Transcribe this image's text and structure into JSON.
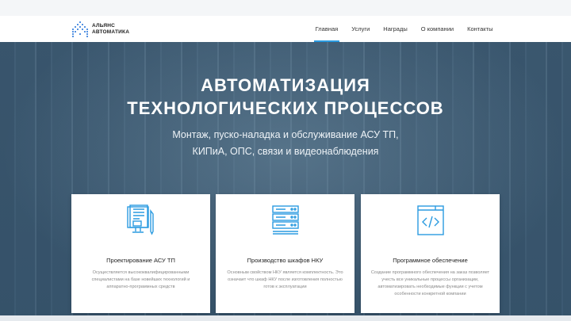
{
  "logo": {
    "line1": "АЛЬЯНС",
    "line2": "АВТОМАТИКА"
  },
  "nav": [
    {
      "label": "Главная",
      "active": true
    },
    {
      "label": "Услуги"
    },
    {
      "label": "Награды"
    },
    {
      "label": "О компании"
    },
    {
      "label": "Контакты"
    }
  ],
  "hero": {
    "title_line1": "АВТОМАТИЗАЦИЯ",
    "title_line2": "ТЕХНОЛОГИЧЕСКИХ ПРОЦЕССОВ",
    "subtitle_line1": "Монтаж, пуско-наладка и обслуживание АСУ ТП,",
    "subtitle_line2": "КИПиА, ОПС, связи и видеонаблюдения"
  },
  "cards": [
    {
      "icon": "design-document-icon",
      "title": "Проектирование АСУ ТП",
      "desc": "Осуществляется высококвалифицированными специалистами на базе новейших технологий и аппаратно-программных средств"
    },
    {
      "icon": "server-rack-icon",
      "title": "Производство шкафов НКУ",
      "desc": "Основным свойством НКУ является комплектность. Это означает что шкаф НКУ после изготовления полностью готов к эксплуатации"
    },
    {
      "icon": "code-window-icon",
      "title": "Программное обеспечение",
      "desc": "Создание программного обеспечения на заказ позволяет учесть все уникальные процессы организации, автоматизировать необходимые функции с учетом особенности конкретной компании"
    }
  ],
  "colors": {
    "accent": "#2b9be0",
    "logo": "#1e6fd9"
  }
}
